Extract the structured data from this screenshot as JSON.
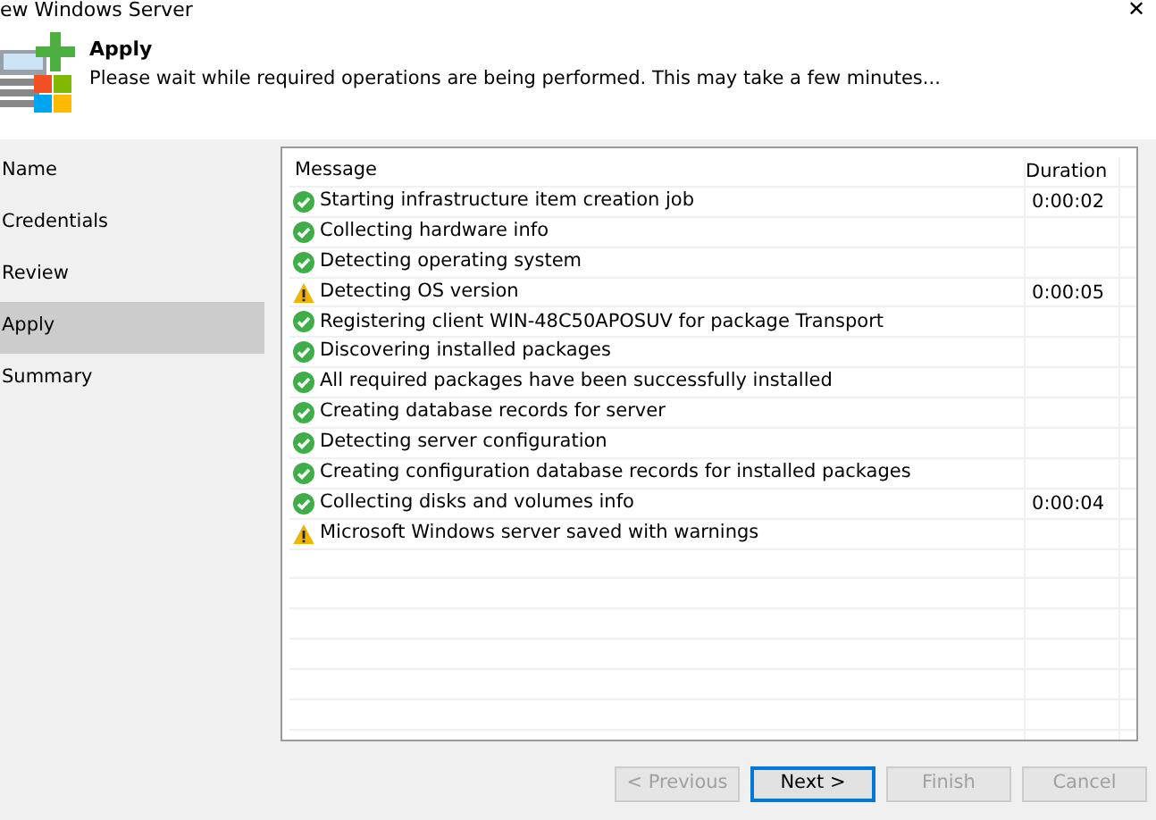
{
  "window": {
    "title": "ew Windows Server",
    "close": "✕"
  },
  "header": {
    "title": "Apply",
    "description": "Please wait while required operations are being performed. This may take a few minutes..."
  },
  "sidebar": {
    "items": [
      {
        "label": "Name",
        "selected": false
      },
      {
        "label": "Credentials",
        "selected": false
      },
      {
        "label": "Review",
        "selected": false
      },
      {
        "label": "Apply",
        "selected": true
      },
      {
        "label": "Summary",
        "selected": false
      }
    ]
  },
  "table": {
    "columns": [
      "Message",
      "Duration"
    ],
    "rows": [
      {
        "kind": "success",
        "message": "Starting infrastructure item creation job",
        "duration": "0:00:02"
      },
      {
        "kind": "success",
        "message": "Collecting hardware info"
      },
      {
        "kind": "success",
        "message": "Detecting operating system"
      },
      {
        "kind": "warning",
        "message": "Detecting OS version",
        "duration": "0:00:05"
      },
      {
        "kind": "success",
        "message": "Registering client WIN-48C50APOSUV for package Transport"
      },
      {
        "kind": "success",
        "message": "Discovering installed packages"
      },
      {
        "kind": "success",
        "message": "All required packages have been successfully installed"
      },
      {
        "kind": "success",
        "message": "Creating database records for server"
      },
      {
        "kind": "success",
        "message": "Detecting server configuration"
      },
      {
        "kind": "success",
        "message": "Creating configuration database records for installed packages"
      },
      {
        "kind": "success",
        "message": "Collecting disks and volumes info",
        "duration": "0:00:04"
      },
      {
        "kind": "warning",
        "message": "Microsoft Windows server saved with warnings"
      }
    ]
  },
  "buttons": [
    {
      "label": "< Previous",
      "disabled": true,
      "focused": false
    },
    {
      "label": "Next >",
      "disabled": false,
      "focused": true
    },
    {
      "label": "Finish",
      "disabled": true,
      "focused": false
    },
    {
      "label": "Cancel",
      "disabled": true,
      "focused": false
    }
  ]
}
